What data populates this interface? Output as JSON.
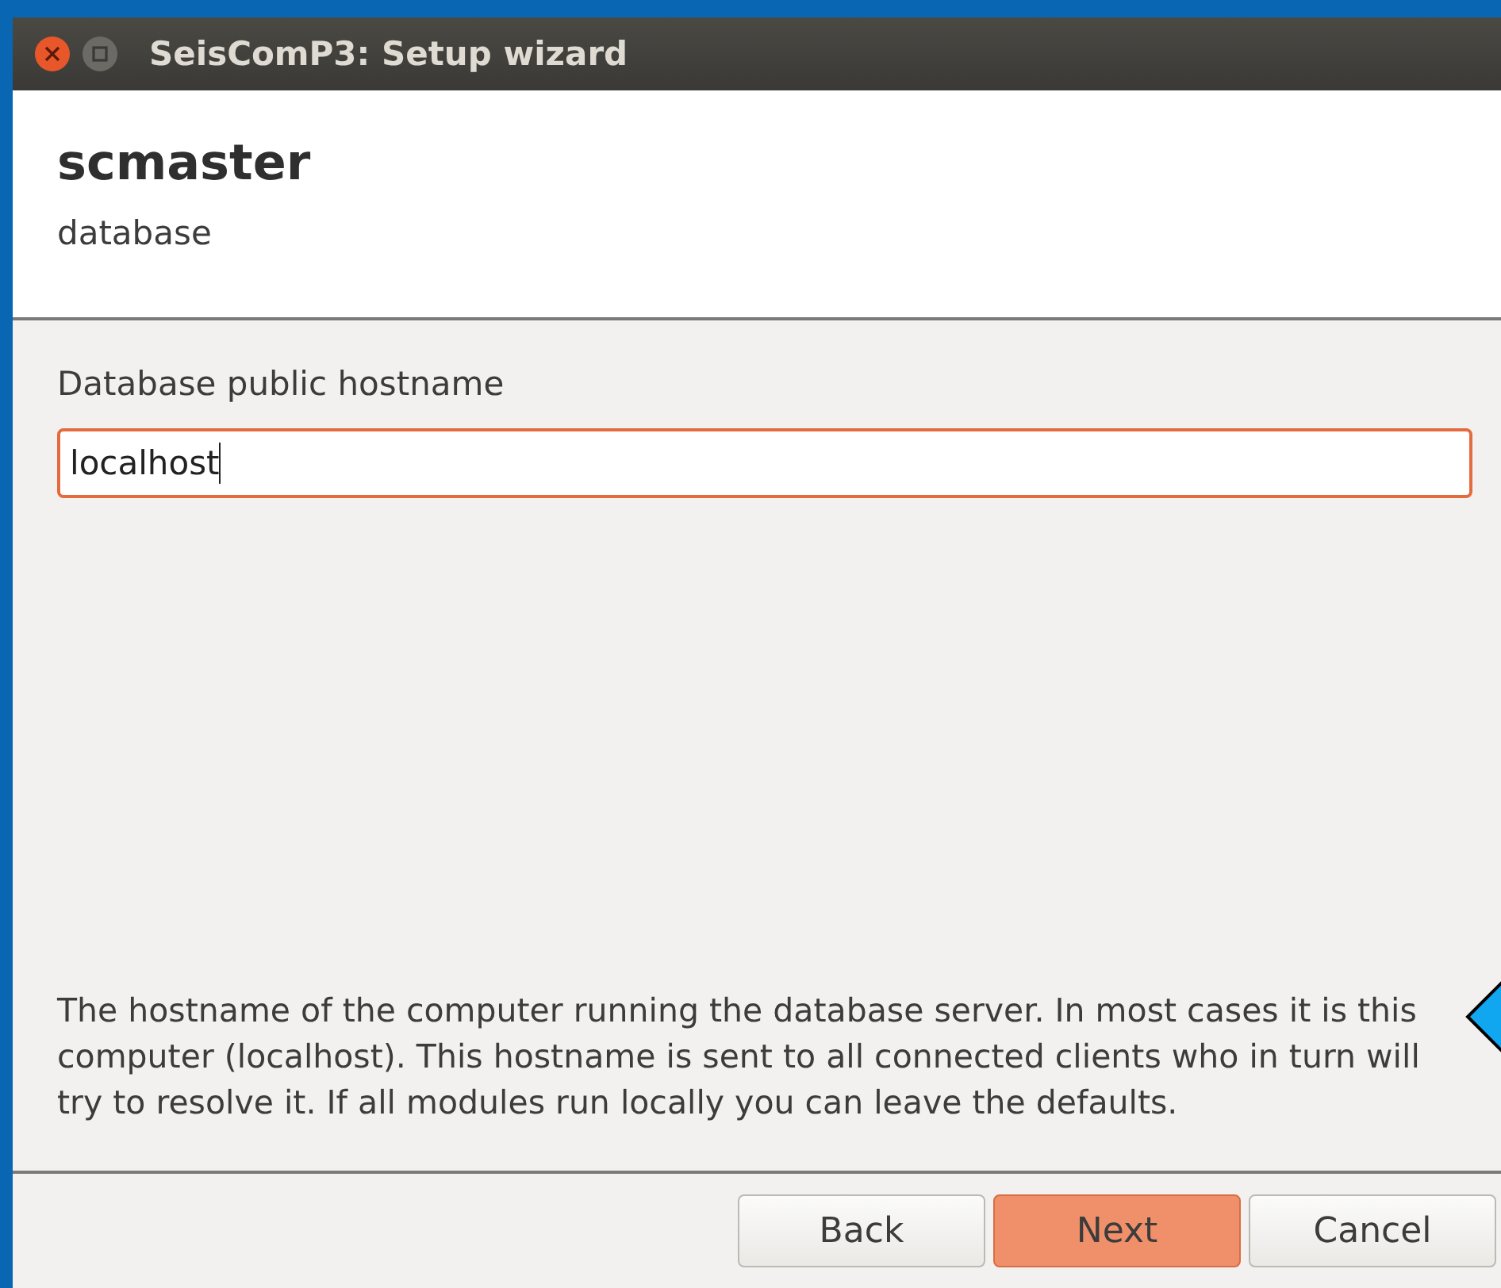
{
  "window": {
    "title": "SeisComP3: Setup wizard"
  },
  "header": {
    "title": "scmaster",
    "subtitle": "database"
  },
  "field": {
    "label": "Database public hostname",
    "value": "localhost",
    "focused": true
  },
  "description": "The hostname of the computer running the database server. In most cases it is this computer (localhost). This hostname is sent to all connected clients who in turn will try to resolve it. If all modules run locally you can leave the defaults.",
  "buttons": [
    {
      "label": "Back",
      "default": false
    },
    {
      "label": "Next",
      "default": true
    },
    {
      "label": "Cancel",
      "default": false
    }
  ]
}
